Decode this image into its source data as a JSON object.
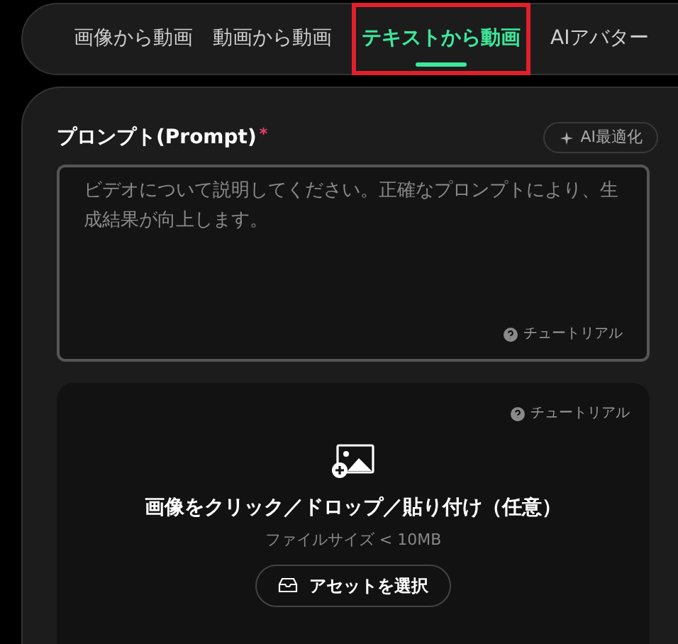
{
  "tabs": [
    {
      "label": "画像から動画",
      "selected": false,
      "highlighted": false
    },
    {
      "label": "動画から動画",
      "selected": false,
      "highlighted": false
    },
    {
      "label": "テキストから動画",
      "selected": true,
      "highlighted": true
    },
    {
      "label": "AIアバター",
      "selected": false,
      "highlighted": false
    }
  ],
  "prompt": {
    "label": "プロンプト(Prompt)",
    "required_mark": "*",
    "optimize_button": "AI最適化",
    "placeholder": "ビデオについて説明してください。正確なプロンプトにより、生成結果が向上します。",
    "tutorial": "チュートリアル"
  },
  "upload": {
    "tutorial": "チュートリアル",
    "title": "画像をクリック／ドロップ／貼り付け（任意）",
    "hint": "ファイルサイズ < 10MB",
    "asset_button": "アセットを選択"
  }
}
